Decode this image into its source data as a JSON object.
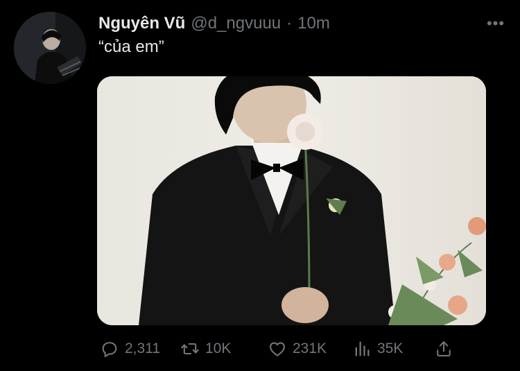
{
  "tweet": {
    "author": {
      "display_name": "Nguyên Vũ",
      "handle": "@d_ngvuuu",
      "separator": "·",
      "time": "10m",
      "avatar_icon": "user-avatar-photo"
    },
    "more_icon": "more-options-icon",
    "more_label": "•••",
    "text": "“của em”",
    "media": {
      "kind": "photo"
    },
    "actions": {
      "reply": {
        "icon": "reply-icon",
        "count": "2,311"
      },
      "retweet": {
        "icon": "retweet-icon",
        "count": "10K"
      },
      "like": {
        "icon": "heart-icon",
        "count": "231K"
      },
      "views": {
        "icon": "views-icon",
        "count": "35K"
      },
      "share": {
        "icon": "share-icon"
      }
    }
  },
  "colors": {
    "background": "#000000",
    "primary_text": "#e7e9ea",
    "secondary_text": "#71767b"
  }
}
